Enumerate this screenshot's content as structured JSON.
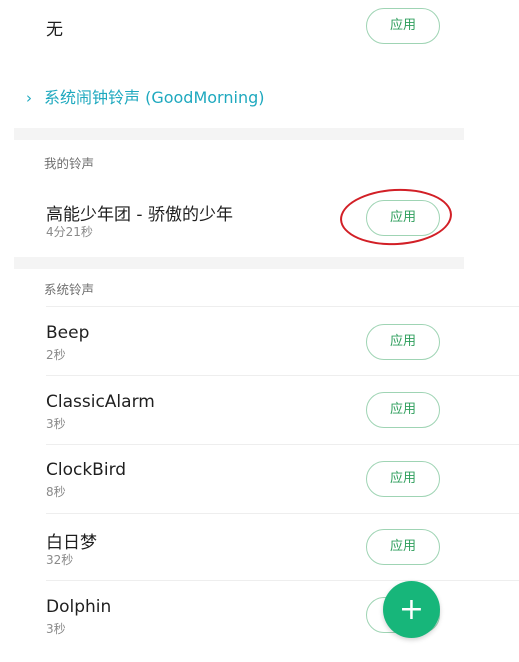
{
  "none_option": {
    "label": "无",
    "apply_label": "应用"
  },
  "current_alarm": {
    "text": "系统闹钟铃声 (GoodMorning)",
    "chevron": "›"
  },
  "my_ringtones": {
    "header": "我的铃声",
    "items": [
      {
        "title": "高能少年团 - 骄傲的少年",
        "duration": "4分21秒",
        "apply_label": "应用"
      }
    ]
  },
  "system_ringtones": {
    "header": "系统铃声",
    "items": [
      {
        "title": "Beep",
        "duration": "2秒",
        "apply_label": "应用"
      },
      {
        "title": "ClassicAlarm",
        "duration": "3秒",
        "apply_label": "应用"
      },
      {
        "title": "ClockBird",
        "duration": "8秒",
        "apply_label": "应用"
      },
      {
        "title": "白日梦",
        "duration": "32秒",
        "apply_label": "应用"
      },
      {
        "title": "Dolphin",
        "duration": "3秒",
        "apply_label": "应用"
      }
    ]
  },
  "fab": {
    "icon": "plus-icon",
    "glyph": "+"
  },
  "colors": {
    "accent_green": "#2e9e5c",
    "fab_green": "#17b67a",
    "link_teal": "#1fa9bf",
    "annotation_red": "#d21f26"
  }
}
